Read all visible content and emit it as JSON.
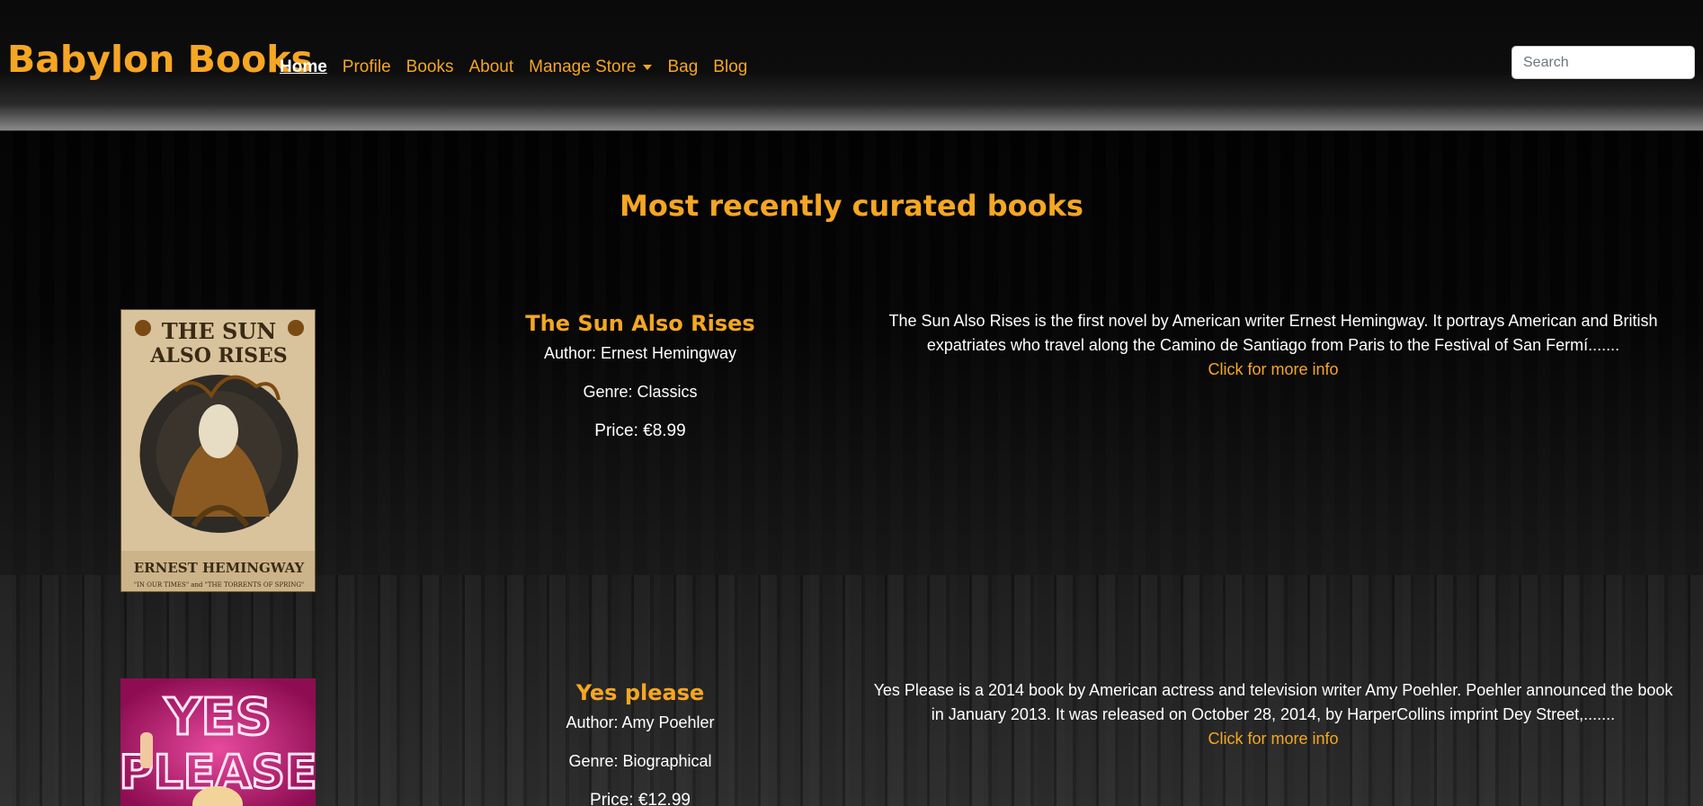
{
  "navbar": {
    "brand": "Babylon Books",
    "links": [
      {
        "label": "Home",
        "active": true
      },
      {
        "label": "Profile"
      },
      {
        "label": "Books"
      },
      {
        "label": "About"
      },
      {
        "label": "Manage Store"
      },
      {
        "label": "Bag"
      },
      {
        "label": "Blog"
      }
    ],
    "search_placeholder": "Search"
  },
  "main": {
    "title": "Most recently curated books",
    "books": [
      {
        "title": "The Sun Also Rises",
        "author": "Author: Ernest Hemingway",
        "genre": "Genre: Classics",
        "price": "Price: €8.99",
        "description": "The Sun Also Rises is the first novel by American writer Ernest Hemingway. It portrays American and British expatriates who travel along the Camino de Santiago from Paris to the Festival of San Fermí.......",
        "more_link": "Click for more info",
        "cover_text_top": "THE SUN ALSO RISES",
        "cover_text_bottom": "ERNEST HEMINGWAY",
        "cover_subtext": "\"IN OUR TIMES\" and \"THE TORRENTS OF SPRING\""
      },
      {
        "title": "Yes please",
        "author": "Author: Amy Poehler",
        "genre": "Genre: Biographical",
        "price": "Price: €12.99",
        "description": "Yes Please is a 2014 book by American actress and television writer Amy Poehler. Poehler announced the book in January 2013. It was released on October 28, 2014, by HarperCollins imprint Dey Street,.......",
        "more_link": "Click for more info",
        "cover_text_top": "YES",
        "cover_text_mid": "PLEASE"
      }
    ]
  },
  "colors": {
    "accent": "#f5a623",
    "background": "#050505",
    "text": "#ffffff"
  }
}
